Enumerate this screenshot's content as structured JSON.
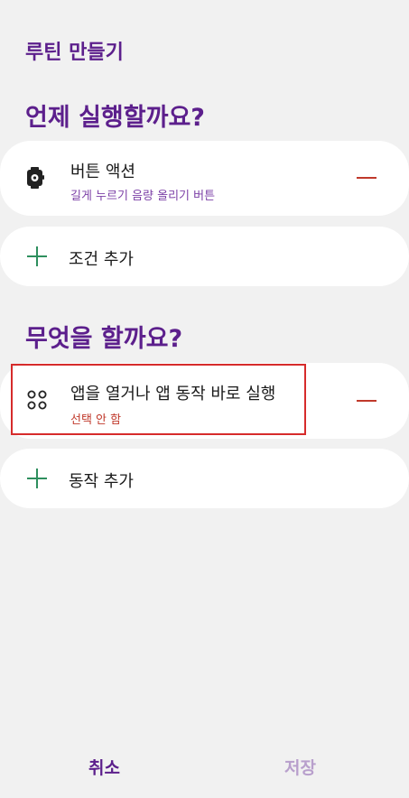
{
  "header": {
    "title": "루틴 만들기"
  },
  "when": {
    "heading": "언제 실행할까요?",
    "conditions": [
      {
        "label": "버튼 액션",
        "sublabel": "길게 누르기 음량 올리기 버튼",
        "icon": "smartwatch-gear-icon"
      }
    ],
    "add_label": "조건 추가"
  },
  "what": {
    "heading": "무엇을 할까요?",
    "actions": [
      {
        "label": "앱을 열거나 앱 동작 바로 실행",
        "sublabel": "선택 안 함",
        "icon": "app-grid-icon"
      }
    ],
    "add_label": "동작 추가"
  },
  "footer": {
    "cancel_label": "취소",
    "save_label": "저장"
  },
  "colors": {
    "accent": "#5c1f8c",
    "sublabel_purple": "#7b3fa6",
    "sublabel_red": "#c0392b",
    "plus_green": "#2e8f5e",
    "save_disabled": "#b89fcc",
    "background": "#f1f1f1"
  }
}
